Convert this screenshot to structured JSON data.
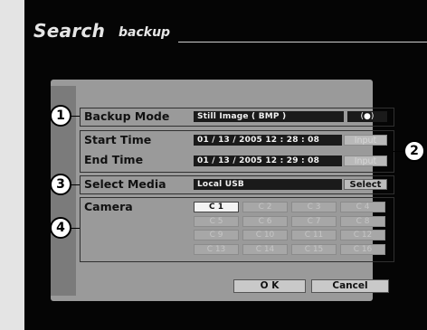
{
  "screen": {
    "title": "Search",
    "subtitle": "backup"
  },
  "callouts": [
    "1",
    "2",
    "3",
    "4"
  ],
  "backup_mode": {
    "label": "Backup  Mode",
    "value": "Still Image ( BMP )",
    "toggle_label": "(●)"
  },
  "start_time": {
    "label": "Start Time",
    "value": "01 / 13 / 2005  12 : 28 : 08",
    "button": "Input"
  },
  "end_time": {
    "label": "End Time",
    "value": "01 / 13 / 2005  12 : 29 : 08",
    "button": "Input"
  },
  "select_media": {
    "label": "Select Media",
    "value": "Local USB",
    "button": "Select"
  },
  "camera": {
    "label": "Camera",
    "selected": "C 1",
    "buttons": [
      "C 1",
      "C 2",
      "C 3",
      "C 4",
      "C 5",
      "C 6",
      "C 7",
      "C 8",
      "C 9",
      "C 10",
      "C 11",
      "C 12",
      "C 13",
      "C 14",
      "C 15",
      "C 16"
    ]
  },
  "actions": {
    "ok": "O K",
    "cancel": "Cancel"
  }
}
